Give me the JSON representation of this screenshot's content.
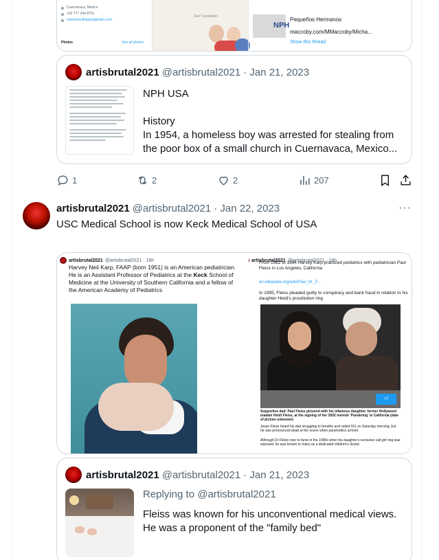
{
  "top_card": {
    "left_lines": [
      "Cuernavaca, Mexico",
      "+52 777 244 8751",
      "rainbowcolloquiodgarden.com"
    ],
    "photos_label": "Photos",
    "see_all_label": "See all photos",
    "mid_caption": "See Translation",
    "right_title": "Pequeños Hermanos",
    "right_url": "maccoby.com/MMaccoby/Micha...",
    "right_link": "Show this thread",
    "right_logo": "NPH"
  },
  "quote1": {
    "author_name": "artisbrutal2021",
    "author_handle": "@artisbrutal2021",
    "date": "· Jan 21, 2023",
    "title": "NPH USA",
    "subtitle": "History",
    "body": "In 1954, a homeless boy was arrested for stealing from the poor box of a small church in Cuernavaca, Mexico..."
  },
  "actions": {
    "replies": "1",
    "retweets": "2",
    "likes": "2",
    "views": "207"
  },
  "main_tweet": {
    "author_name": "artisbrutal2021",
    "author_handle": "@artisbrutal2021",
    "date": "· Jan 22, 2023",
    "more": "···",
    "text": "USC Medical School is now Keck Medical School of USA"
  },
  "media_left": {
    "name": "artisbrutal2021",
    "handle": "@artisbrutal2021 · 16h",
    "text_1": "Harvey Neil Karp, FAAP (born 1951) is an American pediatrician. He is an Assistant Professor of Pediatrics at the",
    "text_bold": "Keck",
    "text_2": "School of Medicine at the University of Southern California and a fellow of the American Academy of Pediatrics"
  },
  "media_right": {
    "name": "artisbrutal2021",
    "handle": "@artisbrutal2021 · 16h",
    "text_1": "From 1982 to 1984 Harvey Karp practiced pediatrics with pediatrician Paul Fleiss in Los Angeles, California",
    "link": "en.wikipedia.org/wiki/Paul_M._F...",
    "text_2": "In 1995, Fleiss pleaded guilty to conspiracy and bank fraud in relation to his daughter Heidi's prostitution ring",
    "badge": "+7",
    "caption": "Supportive dad: Paul Fleiss pictured with his infamous daughter, former Hollywood madam Heidi Fleiss, at the signing of her 2002 memoir 'Pandering' in California (date of picture unknown)",
    "text_3": "Jesse Fleiss heard his dad struggling to breathe and called 911 on Saturday morning, but he was pronounced dead at the scene when paramedics arrived.",
    "text_4": "Although Dr Fleiss rose to fame in the 1990s when his daughter's exclusive call-girl ring was exposed, he was known to many as a dedicated children's doctor."
  },
  "quote2": {
    "author_name": "artisbrutal2021",
    "author_handle": "@artisbrutal2021",
    "date": "· Jan 21, 2023",
    "replying_to": "Replying to @artisbrutal2021",
    "body": "Fleiss was known for his unconventional medical views. He was a proponent of the \"family bed\""
  },
  "colors": {
    "accent": "#1d9bf0",
    "text": "#0f1419",
    "secondary": "#536471",
    "border": "#cfd9de"
  },
  "icons": [
    "reply-icon",
    "retweet-icon",
    "like-icon",
    "views-icon",
    "bookmark-icon",
    "share-icon",
    "more-icon"
  ]
}
